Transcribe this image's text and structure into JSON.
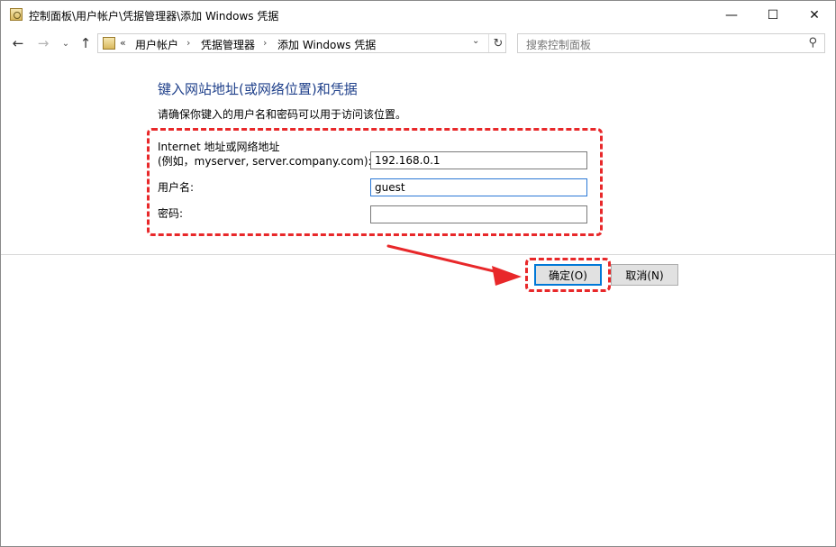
{
  "window": {
    "title": "控制面板\\用户帐户\\凭据管理器\\添加 Windows 凭据",
    "controls": {
      "minimize": "—",
      "maximize": "☐",
      "close": "✕"
    }
  },
  "nav": {
    "back_glyph": "←",
    "forward_glyph": "→",
    "history_glyph": "⌄",
    "up_glyph": "↑",
    "address": {
      "overflow": "«",
      "crumbs": [
        "用户帐户",
        "凭据管理器",
        "添加 Windows 凭据"
      ],
      "separator": "›",
      "dropdown_glyph": "⌄",
      "refresh_glyph": "↻"
    },
    "search": {
      "placeholder": "搜索控制面板",
      "icon": "⚲"
    }
  },
  "form": {
    "heading": "键入网站地址(或网络位置)和凭据",
    "instruction": "请确保你键入的用户名和密码可以用于访问该位置。",
    "address_label_line1": "Internet 地址或网络地址",
    "address_label_line2": "(例如，myserver, server.company.com):",
    "address_value": "192.168.0.1",
    "username_label": "用户名:",
    "username_value": "guest",
    "password_label": "密码:",
    "password_value": ""
  },
  "buttons": {
    "ok": "确定(O)",
    "cancel": "取消(N)"
  },
  "annotation": {
    "color": "#e8282a"
  }
}
